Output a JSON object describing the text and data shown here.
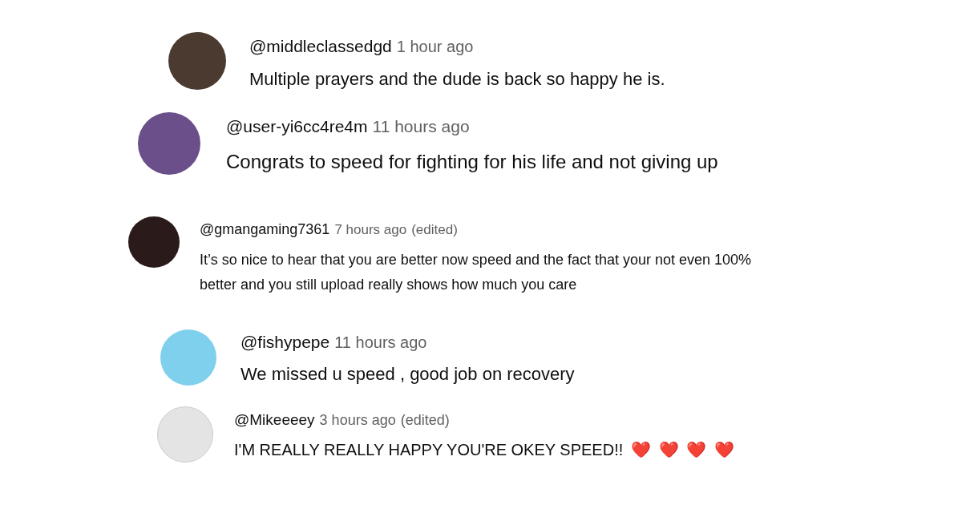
{
  "comments": [
    {
      "author": "@middleclassedgd",
      "time": "1 hour ago",
      "text": "Multiple prayers and the dude is back so happy he is."
    },
    {
      "author": "@user-yi6cc4re4m",
      "time": "11 hours ago",
      "text": "Congrats to speed for fighting for his life and not giving up"
    },
    {
      "author": "@gmangaming7361",
      "time": "7 hours ago",
      "edited_label": "(edited)",
      "text": "It’s so nice to hear that you are better now speed and the fact that your not even 100% better and you still upload really shows how much you care"
    },
    {
      "author": "@fishypepe",
      "time": "11 hours ago",
      "text": "We missed u speed , good job on recovery"
    },
    {
      "author": "@Mikeeeey",
      "time": "3 hours ago",
      "edited_label": "(edited)",
      "text": "I'M REALLY REALLY HAPPY YOU'RE OKEY SPEED!!",
      "emoji": "❤️ ❤️ ❤️ ❤️"
    }
  ]
}
